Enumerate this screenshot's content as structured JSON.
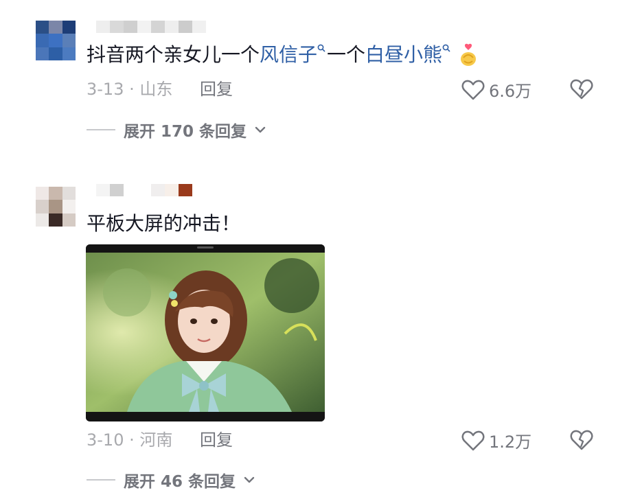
{
  "comments": [
    {
      "text_before": "抖音两个亲女儿一个",
      "link1": "风信子",
      "text_middle": "一个",
      "link2": "白昼小熊",
      "emoji": "finger-heart-emoji",
      "date_location": "3-13 · 山东",
      "reply_label": "回复",
      "likes": "6.6万",
      "expand_label": "展开 170 条回复"
    },
    {
      "text": "平板大屏的冲击！",
      "image": "tablet-girl-green-cardigan-photo",
      "date_location": "3-10 · 河南",
      "reply_label": "回复",
      "likes": "1.2万",
      "expand_label": "展开 46 条回复"
    }
  ],
  "colors": {
    "link": "#2f5fa5",
    "meta": "#a8a9ad",
    "action": "#73757c"
  },
  "icons": [
    "heart-outline-icon",
    "broken-heart-icon",
    "search-mini-icon",
    "chevron-down-icon"
  ]
}
